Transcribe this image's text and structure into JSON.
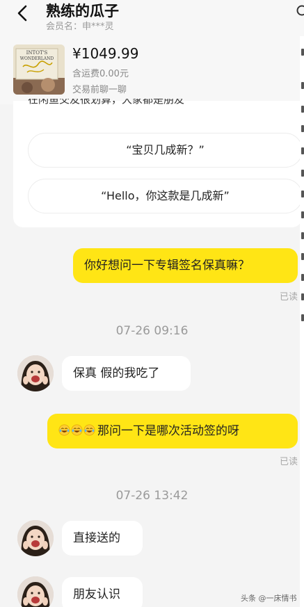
{
  "header": {
    "title": "熟练的瓜子",
    "member": "会员名：申***灵"
  },
  "product": {
    "thumb_text": "INTOT'S WONDERLAND",
    "price": "¥1049.99",
    "shipping": "含运费0.00元",
    "trade_note": "交易前聊一聊"
  },
  "card": {
    "cut_text": "在闲鱼交友很划算，大家都是朋友",
    "suggestions": [
      "“宝贝几成新？”",
      "“Hello，你这款是几成新”"
    ]
  },
  "messages": {
    "m1": "你好想问一下专辑签名保真嘛？",
    "read_1": "已读",
    "time_1": "07-26 09:16",
    "m2": "保真 假的我吃了",
    "m3": "那问一下是哪次活动签的呀",
    "read_2": "已读",
    "time_2": "07-26 13:42",
    "m4": "直接送的",
    "m5": "朋友认识"
  },
  "watermark": "头条 @一床情书",
  "colors": {
    "outgoing_bubble": "#ffe515",
    "incoming_bubble": "#ffffff",
    "background": "#f4f4f4"
  },
  "icons": {
    "back": "chevron-left-icon",
    "search": "search-icon",
    "emoji": "laughing-tears-emoji"
  }
}
